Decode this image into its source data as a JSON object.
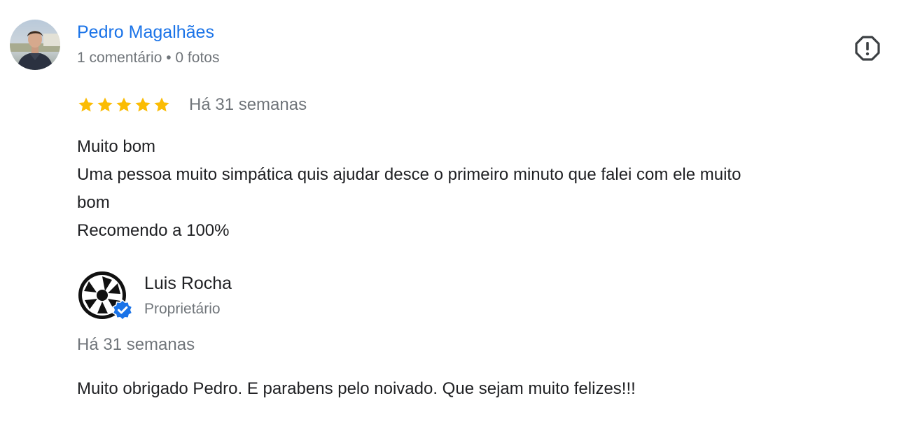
{
  "review": {
    "author": {
      "name": "Pedro Magalhães",
      "meta": "1 comentário • 0 fotos",
      "avatar_icon": "person-photo-avatar"
    },
    "report_icon": "report-flag-icon",
    "rating": 5,
    "rating_max": 5,
    "star_color": "#fbbc04",
    "date": "Há 31 semanas",
    "text_lines": [
      "Muito bom",
      "Uma pessoa muito simpática quis ajudar desce o primeiro minuto que falei com ele muito",
      "bom",
      "Recomendo a 100%"
    ]
  },
  "owner_reply": {
    "name": "Luis Rocha",
    "role": "Proprietário",
    "avatar_icon": "camera-aperture-logo",
    "verified_icon": "verified-badge-icon",
    "verified_color": "#1a73e8",
    "date": "Há 31 semanas",
    "text": "Muito obrigado Pedro. E parabens pelo noivado. Que sejam muito felizes!!!"
  },
  "colors": {
    "link_blue": "#1a73e8",
    "secondary_text": "#70757a",
    "primary_text": "#202124"
  }
}
